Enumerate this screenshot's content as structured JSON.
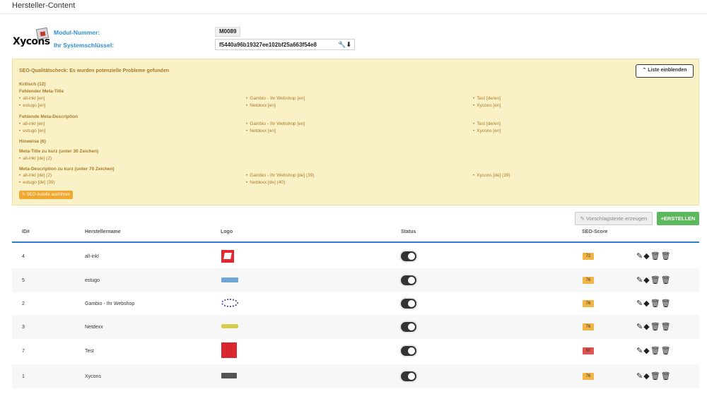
{
  "page": {
    "title": "Hersteller-Content"
  },
  "module": {
    "logo_text": "Xycons",
    "modul_label": "Modul-Nummer:",
    "modul_value": "M0089",
    "key_label": "Ihr Systemschlüssel:",
    "key_value": "f5440a96b19327ee102bf25a663f54e8",
    "key_icons": [
      "wrench-icon",
      "download-icon"
    ]
  },
  "seo": {
    "title": "SEO-Qualitätscheck: Es wurden potenzielle Probleme gefunden",
    "toggle_label": "Liste einblenden",
    "kritisch": "Kritisch (12)",
    "meta_title_heading": "Fehlender Meta-Title",
    "meta_title_items": [
      "all-inkl [en]",
      "Gambio - Ihr Webshop [en]",
      "Test [de/en]",
      "estugo [en]",
      "Netdexx [en]",
      "Xycons [en]"
    ],
    "meta_desc_heading": "Fehlende Meta-Description",
    "meta_desc_items": [
      "all-inkl [en]",
      "Gambio - Ihr Webshop [en]",
      "Test [de/en]",
      "estugo [en]",
      "Netdexx [en]",
      "Xycons [en]"
    ],
    "hinweise": "Hinweise (6)",
    "short_title_heading": "Meta-Title zu kurz (unter 30 Zeichen)",
    "short_title_items": [
      "all-inkl [de] (2)"
    ],
    "short_desc_heading": "Meta-Description zu kurz (unter 70 Zeichen)",
    "short_desc_items": [
      "all-inkl [de] (2)",
      "Gambio - Ihr Webshop [de] (39)",
      "Xycons [de] (39)",
      "estugo [de] (39)",
      "Netdexx [de] (40)"
    ],
    "autofix_label": "SEO-Autofix ausführen"
  },
  "toolbar": {
    "suggest_label": "Vorschlagstexte erzeugen",
    "create_label": "ERSTELLEN"
  },
  "table": {
    "headers": {
      "id": "ID#",
      "name": "Herstellername",
      "logo": "Logo",
      "status": "Status",
      "score": "SEO-Score"
    },
    "rows": [
      {
        "id": "4",
        "name": "all-inkl",
        "logo": "all-inkl-logo",
        "status": true,
        "score": "72",
        "score_color": "#f0b447"
      },
      {
        "id": "5",
        "name": "estugo",
        "logo": "estugo-logo",
        "status": true,
        "score": "76",
        "score_color": "#f0b447"
      },
      {
        "id": "2",
        "name": "Gambio - Ihr Webshop",
        "logo": "gambio-logo",
        "status": true,
        "score": "76",
        "score_color": "#f0b447"
      },
      {
        "id": "3",
        "name": "Netdexx",
        "logo": "netdexx-logo",
        "status": true,
        "score": "76",
        "score_color": "#f0b447"
      },
      {
        "id": "7",
        "name": "Test",
        "logo": "test-logo",
        "status": true,
        "score": "60",
        "score_color": "#e0544f"
      },
      {
        "id": "1",
        "name": "Xycons",
        "logo": "xycons-logo",
        "status": true,
        "score": "76",
        "score_color": "#f0b447"
      }
    ],
    "action_icons": [
      "edit-icon",
      "eraser-icon",
      "trash-icon",
      "delete-icon"
    ]
  },
  "colors": {
    "accent": "#2a7fd0",
    "success": "#5cb85c",
    "warning_bg": "#fbf1c7",
    "warning_text": "#a87a28"
  }
}
